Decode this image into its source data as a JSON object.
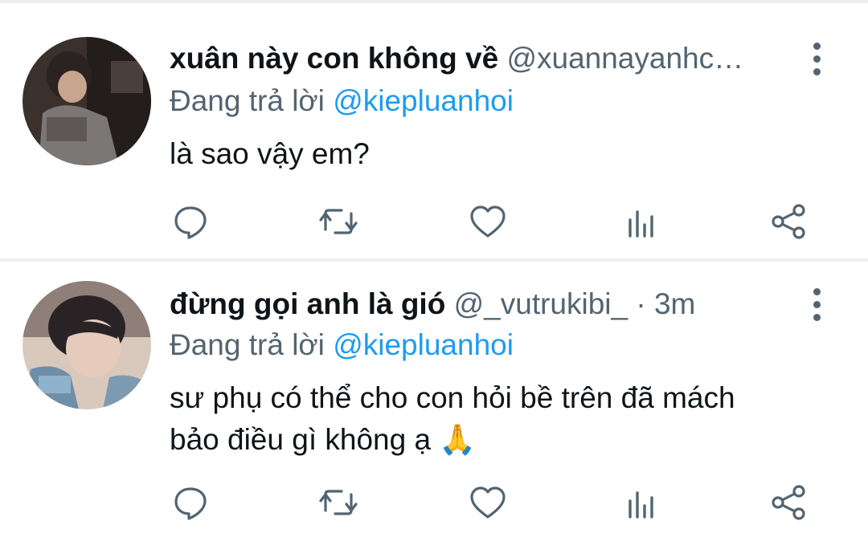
{
  "tweets": [
    {
      "name": "xuân này con không về",
      "handle": "@xuannayanhc…",
      "reply_prefix": "Đang trả lời",
      "reply_to": "@kiepluanhoi",
      "text": "là sao vậy em?",
      "avatar_icon": "user-avatar-photo"
    },
    {
      "name": "đừng gọi anh là gió",
      "handle": "@_vutrukibi_ · 3m",
      "reply_prefix": "Đang trả lời",
      "reply_to": "@kiepluanhoi",
      "text": "sư phụ có thể cho con hỏi bề trên đã mách\nbảo điều gì không ạ 🙏",
      "avatar_icon": "user-avatar-photo"
    }
  ],
  "actions": [
    "reply-icon",
    "retweet-icon",
    "like-icon",
    "analytics-icon",
    "share-icon"
  ],
  "colors": {
    "text": "#0f1419",
    "secondary": "#536471",
    "mention": "#1d9bf0",
    "divider": "#eceff1"
  }
}
